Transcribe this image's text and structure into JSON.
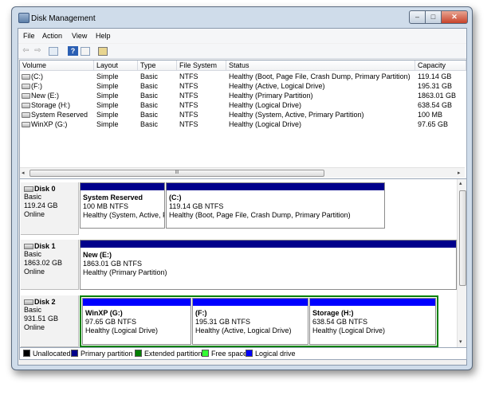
{
  "window": {
    "title": "Disk Management",
    "minimize": "–",
    "maximize": "□",
    "close": "✕"
  },
  "menu": [
    "File",
    "Action",
    "View",
    "Help"
  ],
  "toolbar": [
    "back-icon",
    "forward-icon",
    "console-tree-icon",
    "help-icon",
    "properties-icon",
    "settings-icon"
  ],
  "columns": [
    "Volume",
    "Layout",
    "Type",
    "File System",
    "Status",
    "Capacity"
  ],
  "volumes": [
    [
      "(C:)",
      "Simple",
      "Basic",
      "NTFS",
      "Healthy (Boot, Page File, Crash Dump, Primary Partition)",
      "119.14 GB"
    ],
    [
      "(F:)",
      "Simple",
      "Basic",
      "NTFS",
      "Healthy (Active, Logical Drive)",
      "195.31 GB"
    ],
    [
      "New (E:)",
      "Simple",
      "Basic",
      "NTFS",
      "Healthy (Primary Partition)",
      "1863.01 GB"
    ],
    [
      "Storage (H:)",
      "Simple",
      "Basic",
      "NTFS",
      "Healthy (Logical Drive)",
      "638.54 GB"
    ],
    [
      "System Reserved",
      "Simple",
      "Basic",
      "NTFS",
      "Healthy (System, Active, Primary Partition)",
      "100 MB"
    ],
    [
      "WinXP (G:)",
      "Simple",
      "Basic",
      "NTFS",
      "Healthy (Logical Drive)",
      "97.65 GB"
    ]
  ],
  "scroll_grip": "III",
  "disks": [
    {
      "name": "Disk 0",
      "type": "Basic",
      "size": "119.24 GB",
      "status": "Online",
      "partitions": [
        {
          "name": "System Reserved",
          "size": "100 MB NTFS",
          "status": "Healthy (System, Active, P"
        },
        {
          "name": "(C:)",
          "size": "119.14 GB NTFS",
          "status": "Healthy (Boot, Page File, Crash Dump, Primary Partition)"
        }
      ]
    },
    {
      "name": "Disk 1",
      "type": "Basic",
      "size": "1863.02 GB",
      "status": "Online",
      "partitions": [
        {
          "name": "New  (E:)",
          "size": "1863.01 GB NTFS",
          "status": "Healthy (Primary Partition)"
        }
      ]
    },
    {
      "name": "Disk 2",
      "type": "Basic",
      "size": "931.51 GB",
      "status": "Online",
      "partitions": [
        {
          "name": "WinXP  (G:)",
          "size": "97.65 GB NTFS",
          "status": "Healthy (Logical Drive)"
        },
        {
          "name": "(F:)",
          "size": "195.31 GB NTFS",
          "status": "Healthy (Active, Logical Drive)"
        },
        {
          "name": "Storage  (H:)",
          "size": "638.54 GB NTFS",
          "status": "Healthy (Logical Drive)"
        }
      ]
    }
  ],
  "legend": [
    {
      "label": "Unallocated",
      "color": "#000000"
    },
    {
      "label": "Primary partition",
      "color": "#00008b"
    },
    {
      "label": "Extended partition",
      "color": "#008000"
    },
    {
      "label": "Free space",
      "color": "#33ff33"
    },
    {
      "label": "Logical drive",
      "color": "#0000ff"
    }
  ]
}
